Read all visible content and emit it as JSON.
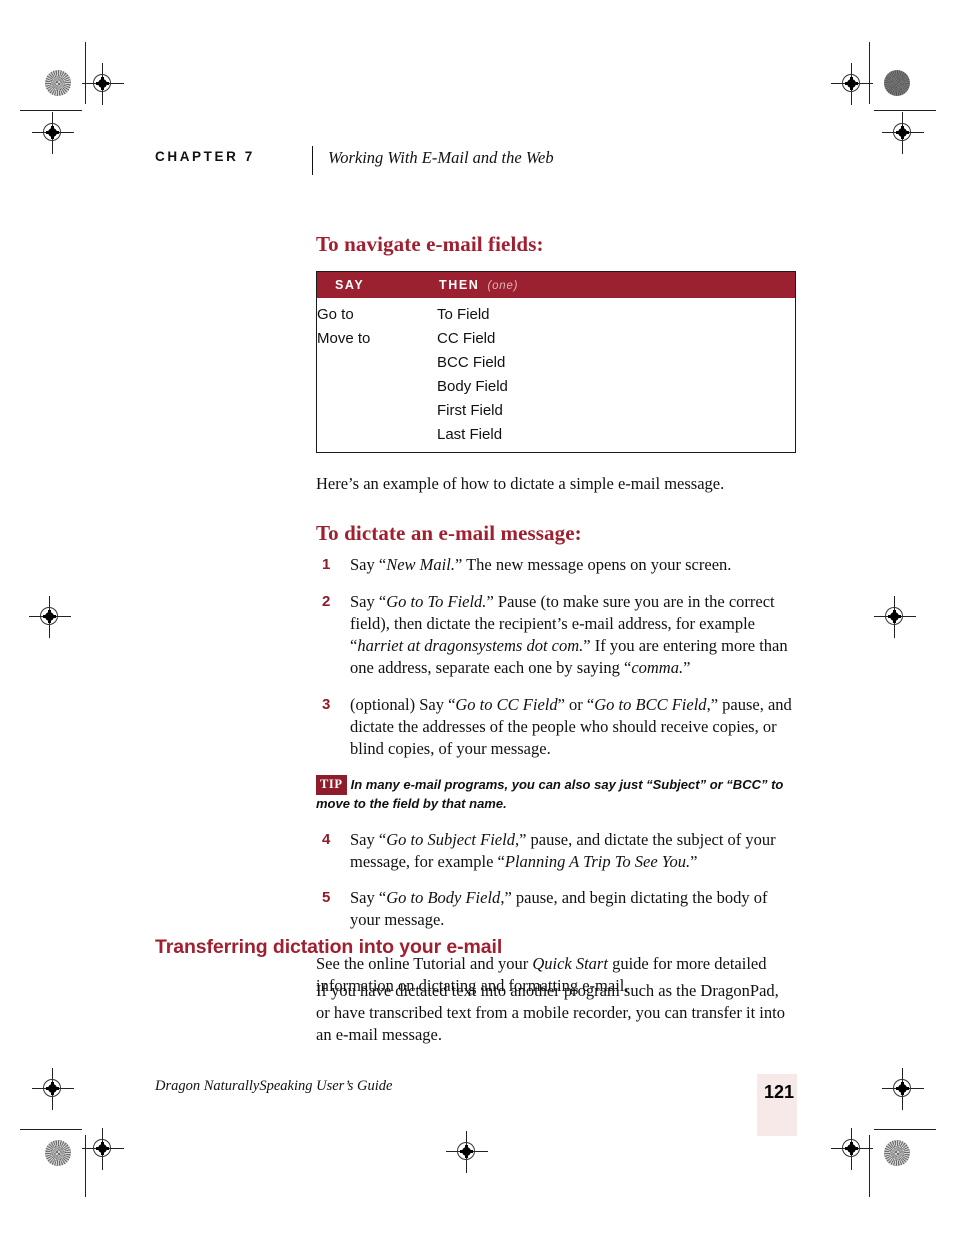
{
  "header": {
    "chapter_label": "CHAPTER 7",
    "running_title": "Working With E-Mail and the Web"
  },
  "navigate_section": {
    "heading": "To navigate e-mail fields:",
    "table": {
      "columns": [
        "SAY",
        "THEN"
      ],
      "then_note": "(one)",
      "rows": [
        {
          "say": "Go to",
          "then": "To Field"
        },
        {
          "say": "Move to",
          "then": "CC Field"
        },
        {
          "say": "",
          "then": "BCC Field"
        },
        {
          "say": "",
          "then": "Body Field"
        },
        {
          "say": "",
          "then": "First Field"
        },
        {
          "say": "",
          "then": "Last Field"
        }
      ]
    }
  },
  "intro_paragraph": "Here’s an example of how to dictate a simple e-mail message.",
  "dictate_section": {
    "heading": "To dictate an e-mail message:",
    "steps": [
      {
        "number": "1",
        "parts": [
          {
            "t": "Say “",
            "i": false
          },
          {
            "t": "New Mail.",
            "i": true
          },
          {
            "t": "” The new message opens on your screen.",
            "i": false
          }
        ]
      },
      {
        "number": "2",
        "parts": [
          {
            "t": "Say “",
            "i": false
          },
          {
            "t": "Go to To Field.",
            "i": true
          },
          {
            "t": "” Pause (to make sure you are in the correct field), then dictate the recipient’s e-mail address, for example “",
            "i": false
          },
          {
            "t": "harriet at dragonsystems dot com.",
            "i": true
          },
          {
            "t": "” If you are entering more than one address, separate each one by saying “",
            "i": false
          },
          {
            "t": "comma.",
            "i": true
          },
          {
            "t": "”",
            "i": false
          }
        ]
      },
      {
        "number": "3",
        "parts": [
          {
            "t": "(optional) Say “",
            "i": false
          },
          {
            "t": "Go to CC Field",
            "i": true
          },
          {
            "t": "” or “",
            "i": false
          },
          {
            "t": "Go to BCC Field",
            "i": true
          },
          {
            "t": ",” pause, and dictate the addresses of the people who should receive copies, or blind copies, of your message.",
            "i": false
          }
        ]
      },
      {
        "number": "4",
        "parts": [
          {
            "t": "Say “",
            "i": false
          },
          {
            "t": "Go to Subject Field",
            "i": true
          },
          {
            "t": ",” pause, and dictate the subject of your message, for example “",
            "i": false
          },
          {
            "t": "Planning A Trip To See You.",
            "i": true
          },
          {
            "t": "”",
            "i": false
          }
        ]
      },
      {
        "number": "5",
        "parts": [
          {
            "t": "Say “",
            "i": false
          },
          {
            "t": "Go to Body Field",
            "i": true
          },
          {
            "t": ",” pause, and begin dictating the body of your message.",
            "i": false
          }
        ]
      }
    ],
    "tip": {
      "badge": "TIP",
      "text": "In many e-mail programs, you can also say just “Subject” or “BCC” to move to the field by that name."
    },
    "trailing_parts": [
      {
        "t": "See the online Tutorial and your ",
        "i": false
      },
      {
        "t": "Quick Start",
        "i": true
      },
      {
        "t": " guide for more detailed information on dictating and formatting e-mail.",
        "i": false
      }
    ]
  },
  "transfer_section": {
    "heading": "Transferring dictation into your e-mail",
    "paragraph": "If you have dictated text into another program such as the DragonPad, or have transcribed text from a mobile recorder, you can transfer it into an e-mail message."
  },
  "footer": {
    "title": "Dragon NaturallySpeaking User’s Guide",
    "page_number": "121"
  },
  "colors": {
    "heading_red": "#A02030",
    "table_header_red": "#9B2030",
    "step_number_red": "#8E1C2B",
    "tip_badge_red": "#8E1C2B",
    "page_box_pink": "#F6E9E8",
    "then_note_pink": "#E0B6BC"
  }
}
